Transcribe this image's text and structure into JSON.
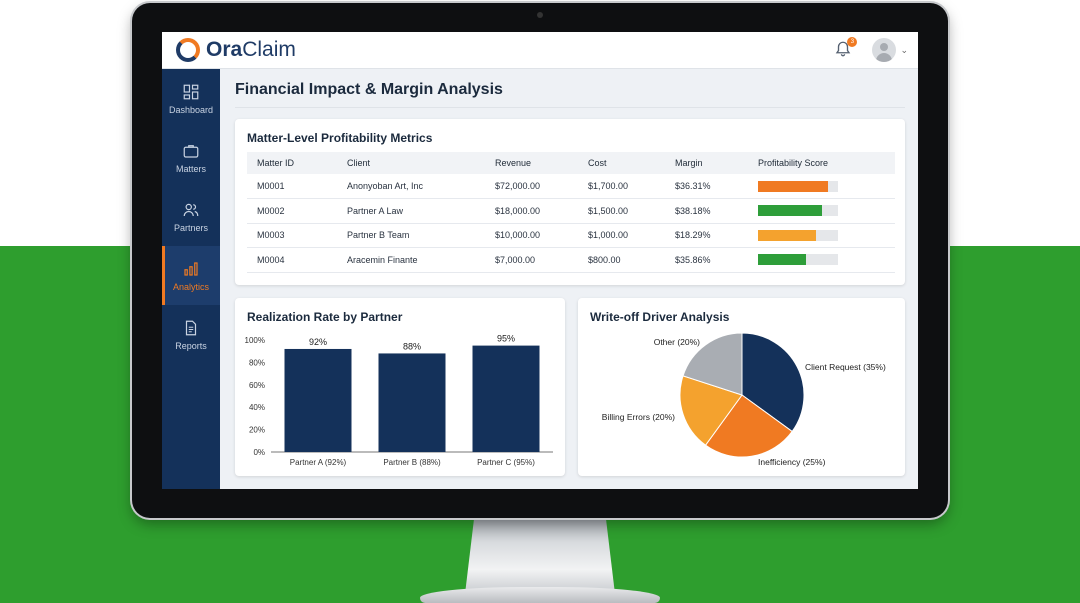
{
  "app": {
    "name_bold": "Ora",
    "name_rest": "Claim",
    "notification_count": "3"
  },
  "sidebar": {
    "items": [
      {
        "label": "Dashboard",
        "icon": "dashboard-icon",
        "active": false
      },
      {
        "label": "Matters",
        "icon": "briefcase-icon",
        "active": false
      },
      {
        "label": "Partners",
        "icon": "users-icon",
        "active": false
      },
      {
        "label": "Analytics",
        "icon": "bar-chart-icon",
        "active": true
      },
      {
        "label": "Reports",
        "icon": "document-icon",
        "active": false
      }
    ]
  },
  "page": {
    "title": "Financial Impact & Margin Analysis"
  },
  "metrics": {
    "title": "Matter-Level Profitability Metrics",
    "columns": [
      "Matter ID",
      "Client",
      "Revenue",
      "Cost",
      "Margin",
      "Profitability Score"
    ],
    "rows": [
      {
        "id": "M0001",
        "client": "Anonyoban Art, Inc",
        "revenue": "$72,000.00",
        "cost": "$1,700.00",
        "margin": "$36.31%",
        "score": 0.88,
        "color": "#f07a22"
      },
      {
        "id": "M0002",
        "client": "Partner A Law",
        "revenue": "$18,000.00",
        "cost": "$1,500.00",
        "margin": "$38.18%",
        "score": 0.8,
        "color": "#2e9e3a"
      },
      {
        "id": "M0003",
        "client": "Partner B Team",
        "revenue": "$10,000.00",
        "cost": "$1,000.00",
        "margin": "$18.29%",
        "score": 0.73,
        "color": "#f4a22e"
      },
      {
        "id": "M0004",
        "client": "Aracemin Finante",
        "revenue": "$7,000.00",
        "cost": "$800.00",
        "margin": "$35.86%",
        "score": 0.6,
        "color": "#2e9e3a"
      }
    ]
  },
  "chart_data": [
    {
      "type": "bar",
      "title": "Realization Rate by Partner",
      "categories": [
        "Partner A (92%)",
        "Partner B (88%)",
        "Partner C (95%)"
      ],
      "values": [
        92,
        88,
        95
      ],
      "data_labels": [
        "92%",
        "88%",
        "95%"
      ],
      "ylim": [
        0,
        100
      ],
      "yticks": [
        "0%",
        "20%",
        "40%",
        "60%",
        "80%",
        "100%"
      ],
      "color": "#14315a",
      "grid": false
    },
    {
      "type": "pie",
      "title": "Write-off Driver Analysis",
      "slices": [
        {
          "label": "Client Request (35%)",
          "value": 35,
          "color": "#14315a"
        },
        {
          "label": "Inefficiency (25%)",
          "value": 25,
          "color": "#f07a22"
        },
        {
          "label": "Billing Errors (20%)",
          "value": 20,
          "color": "#f4a22e"
        },
        {
          "label": "Other (20%)",
          "value": 20,
          "color": "#a9adb3"
        }
      ]
    }
  ]
}
